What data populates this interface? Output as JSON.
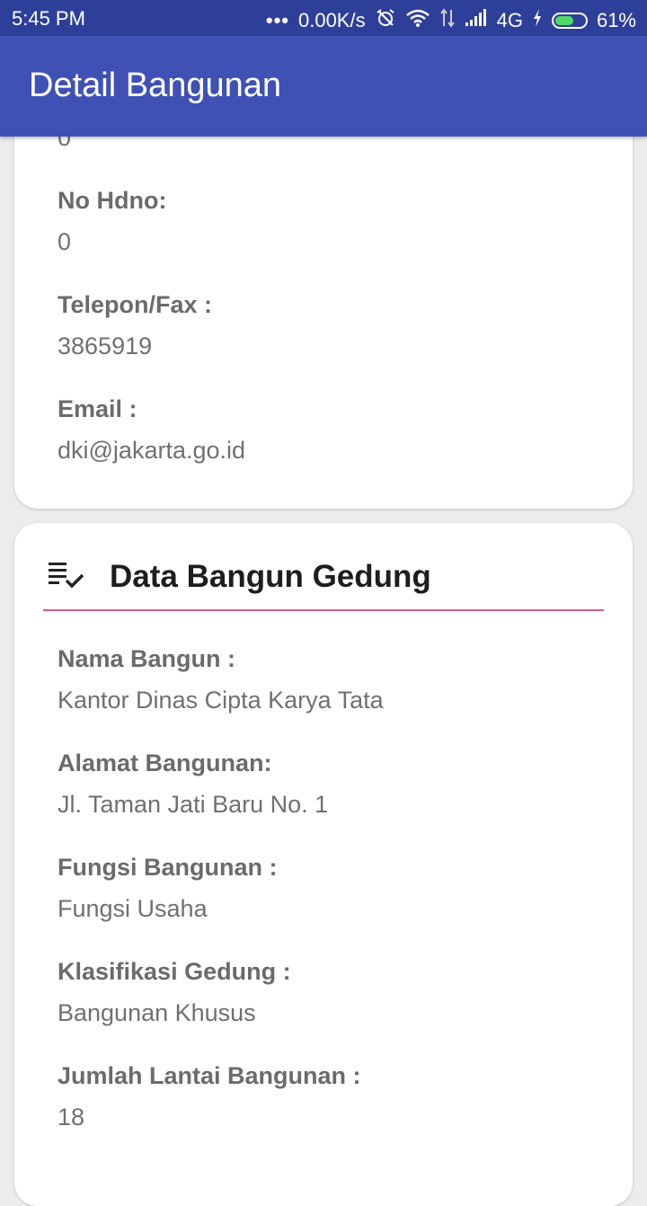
{
  "status_bar": {
    "time": "5:45 PM",
    "dots": "•••",
    "network_speed": "0.00K/s",
    "network_type": "4G",
    "battery_percent": "61%",
    "battery_level": 0.61,
    "icons": [
      "alarm-off-icon",
      "wifi-icon",
      "data-arrows-icon",
      "signal-icon",
      "charging-icon",
      "battery-icon"
    ]
  },
  "app_bar": {
    "title": "Detail Bangunan",
    "color": "#3f51b5"
  },
  "contact_card": {
    "partial_value": "0",
    "fields": [
      {
        "label": "No Hdno:",
        "value": "0"
      },
      {
        "label": "Telepon/Fax :",
        "value": "3865919"
      },
      {
        "label": "Email :",
        "value": "dki@jakarta.go.id"
      }
    ]
  },
  "building_card": {
    "icon": "checklist-icon",
    "title": "Data Bangun Gedung",
    "divider_color": "#d45b94",
    "fields": [
      {
        "label": "Nama Bangun :",
        "value": "Kantor Dinas Cipta Karya Tata"
      },
      {
        "label": "Alamat Bangunan:",
        "value": "Jl. Taman Jati Baru No. 1"
      },
      {
        "label": "Fungsi Bangunan :",
        "value": "Fungsi Usaha"
      },
      {
        "label": "Klasifikasi Gedung :",
        "value": "Bangunan Khusus"
      },
      {
        "label": "Jumlah Lantai Bangunan :",
        "value": "18"
      }
    ]
  }
}
